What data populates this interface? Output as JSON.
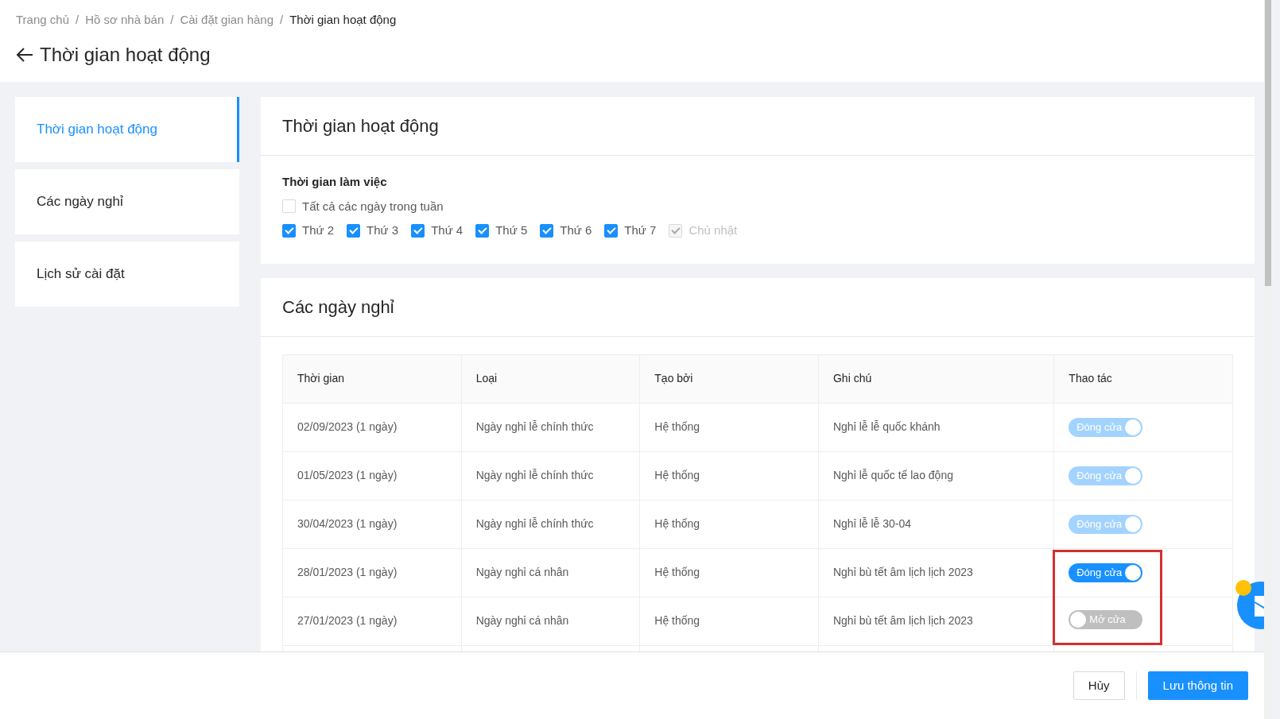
{
  "breadcrumb": [
    {
      "label": "Trang chủ",
      "current": false
    },
    {
      "separator": "/",
      "label": "Hồ sơ nhà bán",
      "current": false
    },
    {
      "separator": "/",
      "label": "Cài đặt gian hàng",
      "current": false
    },
    {
      "separator": "/",
      "label": "Thời gian hoạt động",
      "current": true
    }
  ],
  "page_title": "Thời gian hoạt động",
  "sidebar": {
    "items": [
      {
        "label": "Thời gian hoạt động",
        "selected": true
      },
      {
        "label": "Các ngày nghỉ",
        "selected": false
      },
      {
        "label": "Lịch sử cài đặt",
        "selected": false
      }
    ]
  },
  "working_time": {
    "title": "Thời gian hoạt động",
    "section_label": "Thời gian làm việc",
    "all_days": {
      "label": "Tất cả các ngày trong tuần",
      "checked": false
    },
    "days": [
      {
        "label": "Thứ 2",
        "checked": true,
        "disabled": false
      },
      {
        "label": "Thứ 3",
        "checked": true,
        "disabled": false
      },
      {
        "label": "Thứ 4",
        "checked": true,
        "disabled": false
      },
      {
        "label": "Thứ 5",
        "checked": true,
        "disabled": false
      },
      {
        "label": "Thứ 6",
        "checked": true,
        "disabled": false
      },
      {
        "label": "Thứ 7",
        "checked": true,
        "disabled": false
      },
      {
        "label": "Chủ nhật",
        "checked": true,
        "disabled": true
      }
    ]
  },
  "holidays": {
    "title": "Các ngày nghỉ",
    "table": {
      "columns": [
        "Thời gian",
        "Loại",
        "Tạo bởi",
        "Ghi chú",
        "Thao tác"
      ],
      "rows": [
        {
          "cells": [
            "02/09/2023 (1 ngày)",
            "Ngày nghỉ lễ chính thức",
            "Hệ thống",
            "Nghỉ lễ lễ quốc khánh"
          ],
          "highlighted": false,
          "toggle": {
            "label": "Đóng cửa",
            "on": true,
            "disabled": true
          }
        },
        {
          "cells": [
            "01/05/2023 (1 ngày)",
            "Ngày nghỉ lễ chính thức",
            "Hệ thống",
            "Nghỉ lễ quốc tế lao động"
          ],
          "highlighted": false,
          "toggle": {
            "label": "Đóng cửa",
            "on": true,
            "disabled": true
          }
        },
        {
          "cells": [
            "30/04/2023 (1 ngày)",
            "Ngày nghỉ lễ chính thức",
            "Hệ thống",
            "Nghỉ lễ lễ 30-04"
          ],
          "highlighted": false,
          "toggle": {
            "label": "Đóng cửa",
            "on": true,
            "disabled": true
          }
        },
        {
          "cells": [
            "28/01/2023 (1 ngày)",
            "Ngày nghỉ cá nhân",
            "Hệ thống",
            "Nghỉ bù tết âm lịch lịch 2023"
          ],
          "highlighted": true,
          "toggle": {
            "label": "Đóng cửa",
            "on": true,
            "disabled": false
          }
        },
        {
          "cells": [
            "27/01/2023 (1 ngày)",
            "Ngày nghỉ cá nhân",
            "Hệ thống",
            "Nghỉ bù tết âm lịch lịch 2023"
          ],
          "highlighted": true,
          "toggle": {
            "label": "Mở cửa",
            "on": false,
            "disabled": false
          }
        }
      ]
    }
  },
  "footer": {
    "buttons": [
      {
        "label": "Hủy",
        "kind": "secondary"
      },
      {
        "label": "Lưu thông tin",
        "kind": "primary"
      }
    ]
  }
}
